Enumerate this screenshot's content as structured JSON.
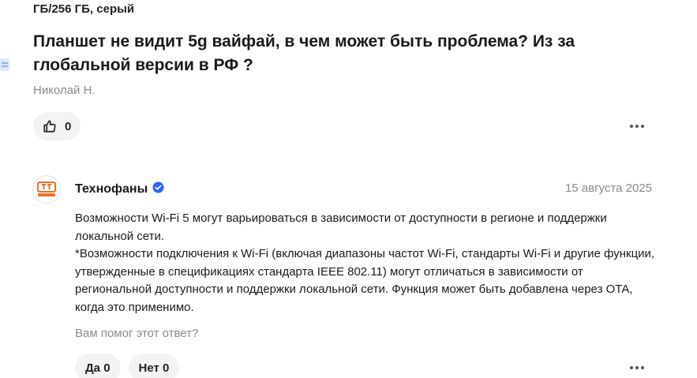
{
  "product": {
    "variant": "ГБ/256 ГБ, серый"
  },
  "question": {
    "title": "Планшет не видит 5g вайфай, в чем может быть проблема? Из за глобальной версии в РФ ?",
    "author": "Николай Н.",
    "likes": "0"
  },
  "answer": {
    "author": "Технофаны",
    "verified": true,
    "date": "15 августа 2025",
    "paragraph1": "Возможности Wi-Fi 5 могут варьироваться в зависимости от доступности в регионе и поддержки локальной сети.",
    "paragraph2": "*Возможности подключения к Wi-Fi (включая диапазоны частот Wi-Fi, стандарты Wi-Fi и другие функции, утвержденные в спецификациях стандарта IEEE 802.11) могут отличаться в зависимости от региональной доступности и поддержки локальной сети. Функция может быть добавлена через OTA, когда это применимо.",
    "helpful_question": "Вам помог этот ответ?",
    "yes_label": "Да 0",
    "no_label": "Нет 0"
  },
  "colors": {
    "accent_verified": "#2962ff",
    "muted_text": "#8a8a8a",
    "pill_bg": "#f2f3f5",
    "logo_orange": "#e8742a"
  },
  "icons": {
    "like": "thumbs-up-icon",
    "more": "more-dots-icon",
    "verified": "verified-check-icon"
  }
}
